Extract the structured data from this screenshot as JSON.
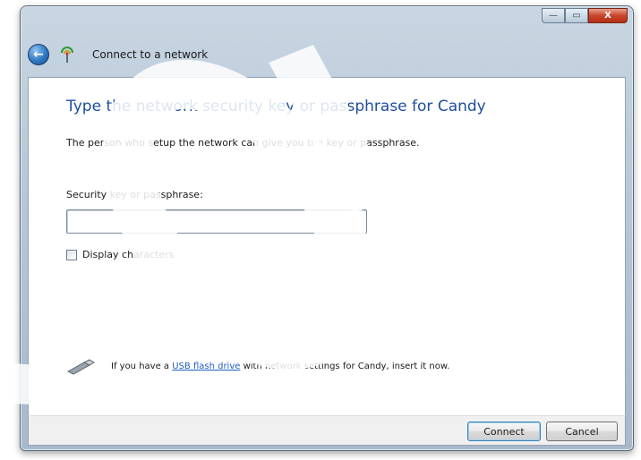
{
  "window": {
    "controls": {
      "minimize": "—",
      "maximize": "▭",
      "close": "X"
    }
  },
  "nav": {
    "title": "Connect to a network",
    "back_icon": "back-arrow-icon",
    "network_icon": "wireless-network-icon"
  },
  "main": {
    "heading": "Type the network security key or passphrase for Candy",
    "description": "The person who setup the network can give you the key or passphrase.",
    "field_label": "Security key or passphrase:",
    "key_value": "",
    "display_characters_label": "Display characters",
    "display_characters_checked": false,
    "usb": {
      "text_before": "If you have a ",
      "link": "USB flash drive",
      "text_after": " with network settings for Candy, insert it now.",
      "icon": "usb-drive-icon"
    }
  },
  "footer": {
    "connect_label": "Connect",
    "cancel_label": "Cancel"
  },
  "colors": {
    "heading": "#1e4f9c",
    "link": "#1f5fbf",
    "close_button": "#c9452b"
  }
}
